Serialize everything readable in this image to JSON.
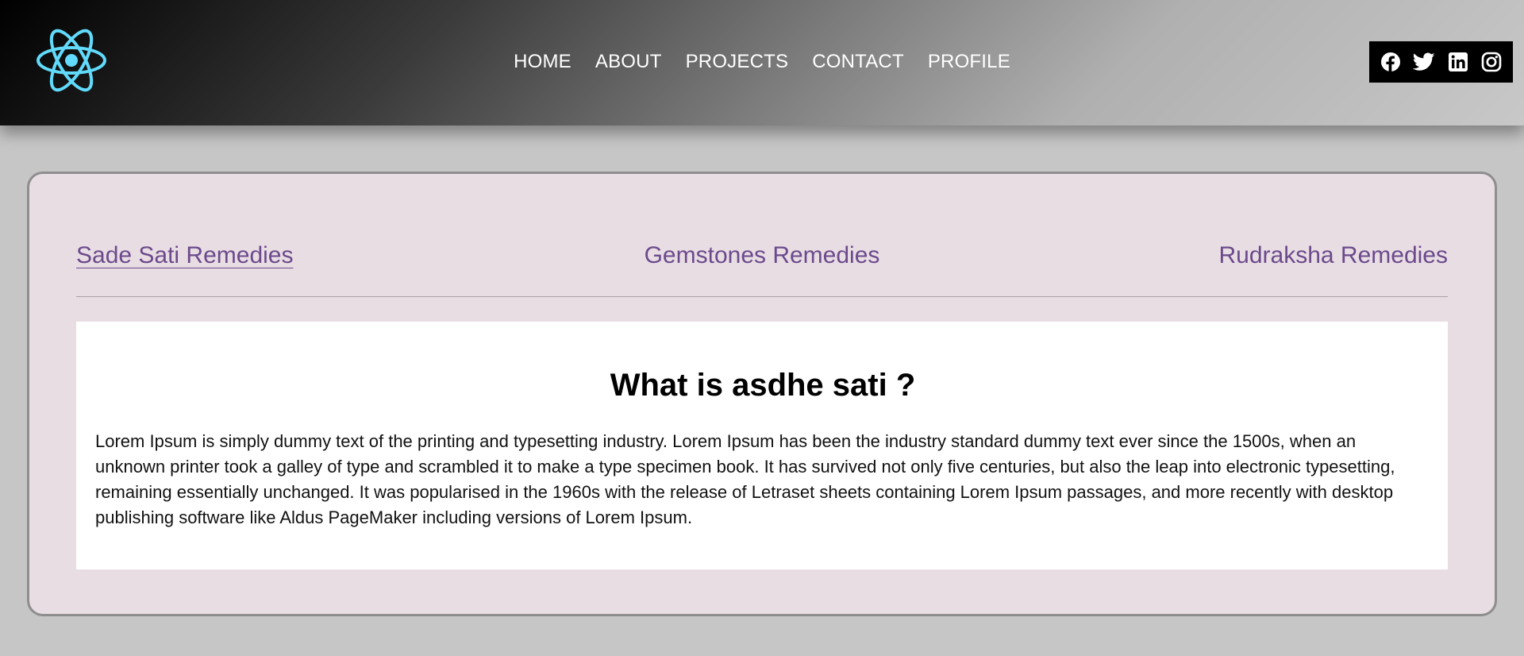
{
  "header": {
    "logo_icon": "react-atom-logo",
    "nav": [
      "HOME",
      "ABOUT",
      "PROJECTS",
      "CONTACT",
      "PROFILE"
    ],
    "social_icons": [
      "facebook-icon",
      "twitter-icon",
      "linkedin-icon",
      "instagram-icon"
    ]
  },
  "tabs": {
    "items": [
      "Sade Sati Remedies",
      "Gemstones Remedies",
      "Rudraksha Remedies"
    ],
    "active": "Sade Sati Remedies"
  },
  "content": {
    "heading": "What is asdhe sati ?",
    "body": "Lorem Ipsum is simply dummy text of the printing and typesetting industry. Lorem Ipsum has been the industry standard dummy text ever since the 1500s, when an unknown printer took a galley of type and scrambled it to make a type specimen book. It has survived not only five centuries, but also the leap into electronic typesetting, remaining essentially unchanged. It was popularised in the 1960s with the release of Letraset sheets containing Lorem Ipsum passages, and more recently with desktop publishing software like Aldus PageMaker including versions of Lorem Ipsum."
  },
  "colors": {
    "page_bg": "#c6c6c6",
    "card_bg": "#e9dde4",
    "tab_text": "#6b4a8c",
    "logo": "#61dafb"
  }
}
